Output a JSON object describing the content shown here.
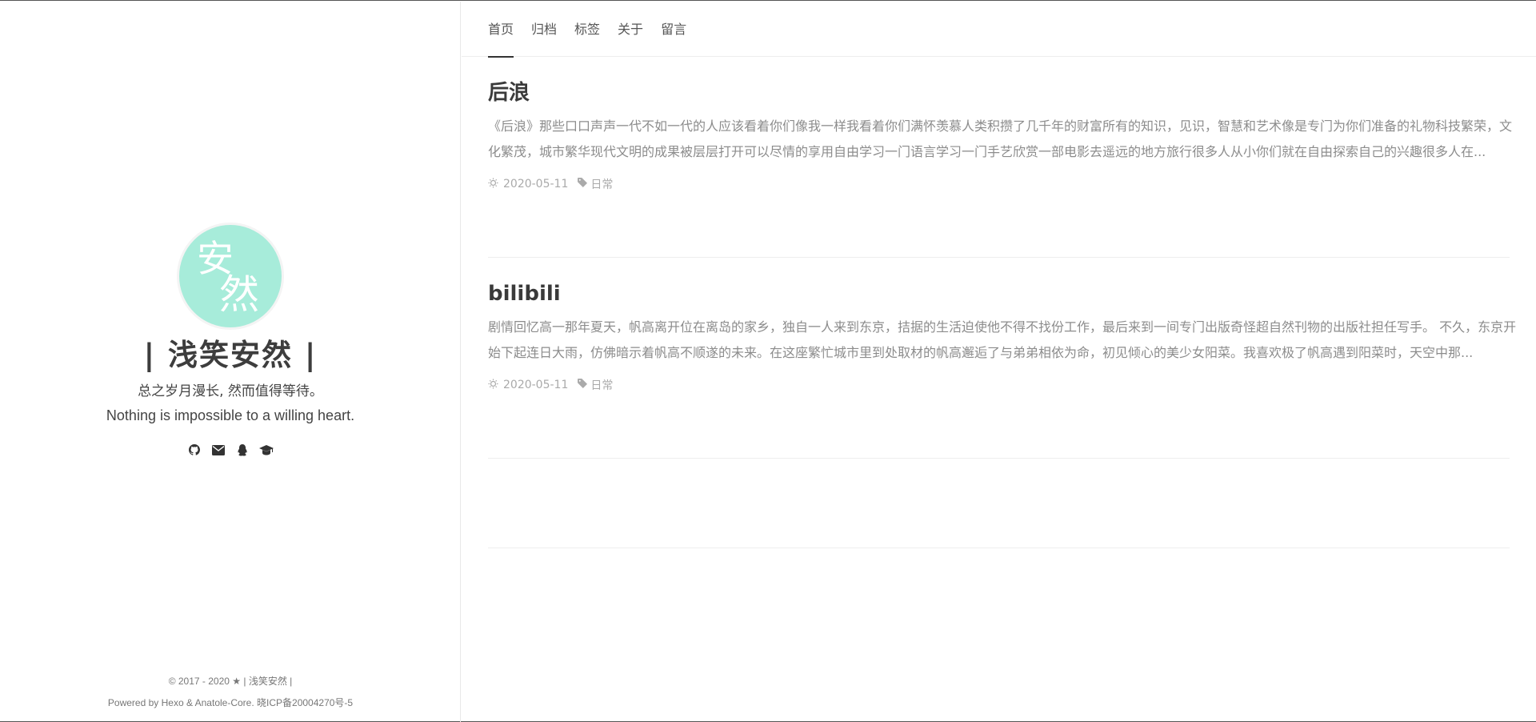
{
  "sidebar": {
    "avatar_text": [
      "安",
      "然"
    ],
    "site_title": "| 浅笑安然 |",
    "motto_cn": "总之岁月漫长, 然而值得等待。",
    "motto_en": "Nothing is impossible to a willing heart.",
    "social_icons": [
      "github-icon",
      "envelope-icon",
      "qq-icon",
      "graduation-cap-icon"
    ],
    "footer": {
      "copyright": "© 2017 - 2020",
      "site_link": "| 浅笑安然 |",
      "powered": "Powered by Hexo & Anatole-Core.",
      "icp": "晓ICP备20004270号-5"
    }
  },
  "nav": {
    "items": [
      {
        "label": "首页",
        "active": true
      },
      {
        "label": "归档",
        "active": false
      },
      {
        "label": "标签",
        "active": false
      },
      {
        "label": "关于",
        "active": false
      },
      {
        "label": "留言",
        "active": false
      }
    ]
  },
  "posts": [
    {
      "title": "后浪",
      "excerpt": "《后浪》那些口口声声一代不如一代的人应该看着你们像我一样我看着你们满怀羡慕人类积攒了几千年的财富所有的知识，见识，智慧和艺术像是专门为你们准备的礼物科技繁荣，文化繁茂，城市繁华现代文明的成果被层层打开可以尽情的享用自由学习一门语言学习一门手艺欣赏一部电影去遥远的地方旅行很多人从小你们就在自由探索自己的兴趣很多人在...",
      "date": "2020-05-11",
      "tag": "日常"
    },
    {
      "title": "bilibili",
      "excerpt": "剧情回忆高一那年夏天，帆高离开位在离岛的家乡，独自一人来到东京，拮据的生活迫使他不得不找份工作，最后来到一间专门出版奇怪超自然刊物的出版社担任写手。 不久，东京开始下起连日大雨，仿佛暗示着帆高不顺遂的未来。在这座繁忙城市里到处取材的帆高邂逅了与弟弟相依为命，初见倾心的美少女阳菜。我喜欢极了帆高遇到阳菜时，天空中那...",
      "date": "2020-05-11",
      "tag": "日常"
    }
  ],
  "colors": {
    "avatar_bg": "#a7ecda",
    "title": "#3a3a3a",
    "excerpt": "#8c8c8c",
    "meta": "#aaaaaa"
  }
}
